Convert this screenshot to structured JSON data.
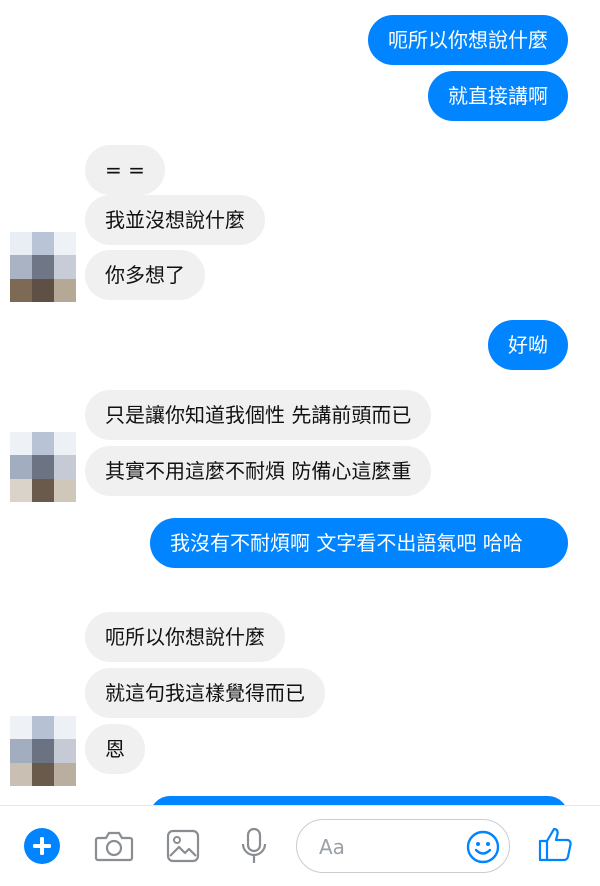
{
  "conversation": {
    "messages": [
      {
        "side": "out",
        "text": "呃所以你想說什麼"
      },
      {
        "side": "out",
        "text": "就直接講啊"
      },
      {
        "side": "in",
        "text": "= ="
      },
      {
        "side": "in",
        "text": "我並沒想說什麼"
      },
      {
        "side": "in",
        "text": "你多想了"
      },
      {
        "side": "out",
        "text": "好呦"
      },
      {
        "side": "in",
        "text": "只是讓你知道我個性 先講前頭而已"
      },
      {
        "side": "in",
        "text": "其實不用這麼不耐煩  防備心這麼重"
      },
      {
        "side": "out",
        "text": "我沒有不耐煩啊 文字看不出語氣吧 哈哈"
      },
      {
        "side": "in",
        "text": "呃所以你想說什麼"
      },
      {
        "side": "in",
        "text": "就這句我這樣覺得而已"
      },
      {
        "side": "in",
        "text": "恩"
      }
    ]
  },
  "composer": {
    "placeholder": "Aa",
    "icons": [
      "plus-icon",
      "camera-icon",
      "image-icon",
      "microphone-icon",
      "emoji-icon",
      "thumbs-up-icon"
    ]
  },
  "colors": {
    "outgoing": "#0084ff",
    "incoming": "#f1f0f0",
    "accent": "#0084ff"
  }
}
